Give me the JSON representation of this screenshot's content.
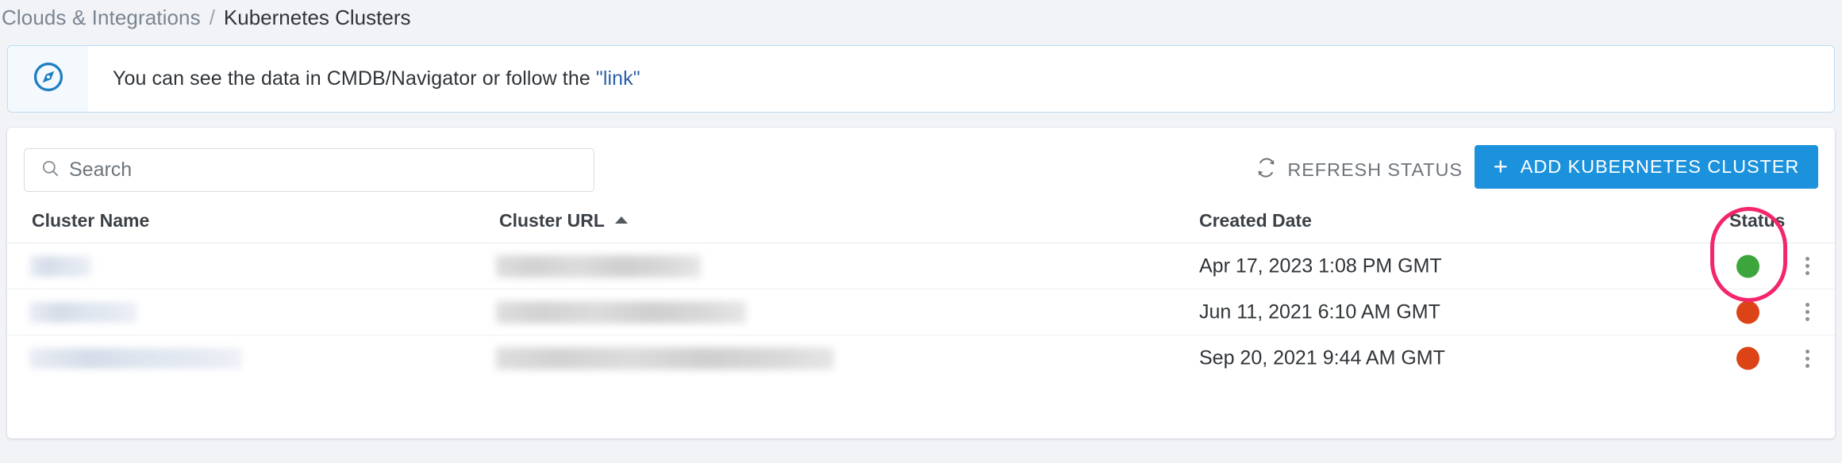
{
  "breadcrumb": {
    "parent": "Clouds & Integrations",
    "separator": "/",
    "current": "Kubernetes Clusters"
  },
  "banner": {
    "icon": "compass-navigator-icon",
    "text_before": "You can see the data in CMDB/Navigator or follow the",
    "link_text": "\"link\"",
    "link_color": "#2b5fa8",
    "border_color": "#bcdcf2",
    "icon_color": "#1f7fc4"
  },
  "toolbar": {
    "search_placeholder": "Search",
    "search_value": "",
    "refresh_label": "REFRESH STATUS",
    "refresh_icon": "refresh-icon",
    "add_label": "ADD KUBERNETES CLUSTER",
    "add_icon": "plus-icon",
    "add_button_color": "#1c92dd"
  },
  "table": {
    "columns": [
      {
        "key": "name",
        "label": "Cluster Name",
        "sorted": false
      },
      {
        "key": "url",
        "label": "Cluster URL",
        "sorted": true,
        "sort_direction": "asc"
      },
      {
        "key": "date",
        "label": "Created Date",
        "sorted": false
      },
      {
        "key": "status",
        "label": "Status",
        "sorted": false
      }
    ],
    "rows": [
      {
        "name_redacted": true,
        "name_width": 78,
        "url_redacted": true,
        "url_width": 258,
        "created_date": "Apr 17, 2023 1:08 PM GMT",
        "status": "healthy",
        "status_color": "#3ca53c",
        "menu_icon": "kebab-menu-icon"
      },
      {
        "name_redacted": true,
        "name_width": 136,
        "url_redacted": true,
        "url_width": 315,
        "created_date": "Jun 11, 2021 6:10 AM GMT",
        "status": "error",
        "status_color": "#dc4418",
        "menu_icon": "kebab-menu-icon"
      },
      {
        "name_redacted": true,
        "name_width": 268,
        "url_redacted": true,
        "url_width": 426,
        "created_date": "Sep 20, 2021 9:44 AM GMT",
        "status": "error",
        "status_color": "#dc4418",
        "menu_icon": "kebab-menu-icon"
      }
    ]
  },
  "annotation": {
    "shape": "ellipse",
    "color": "#f4256b",
    "target": "status-column"
  }
}
